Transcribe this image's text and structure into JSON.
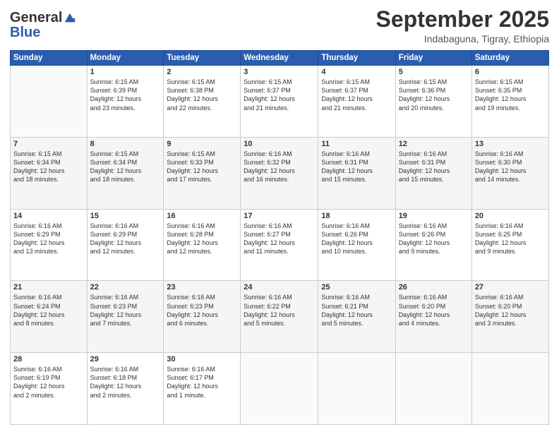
{
  "header": {
    "logo_general": "General",
    "logo_blue": "Blue",
    "month": "September 2025",
    "location": "Indabaguna, Tigray, Ethiopia"
  },
  "weekdays": [
    "Sunday",
    "Monday",
    "Tuesday",
    "Wednesday",
    "Thursday",
    "Friday",
    "Saturday"
  ],
  "weeks": [
    [
      {
        "num": "",
        "text": ""
      },
      {
        "num": "1",
        "text": "Sunrise: 6:15 AM\nSunset: 6:39 PM\nDaylight: 12 hours\nand 23 minutes."
      },
      {
        "num": "2",
        "text": "Sunrise: 6:15 AM\nSunset: 6:38 PM\nDaylight: 12 hours\nand 22 minutes."
      },
      {
        "num": "3",
        "text": "Sunrise: 6:15 AM\nSunset: 6:37 PM\nDaylight: 12 hours\nand 21 minutes."
      },
      {
        "num": "4",
        "text": "Sunrise: 6:15 AM\nSunset: 6:37 PM\nDaylight: 12 hours\nand 21 minutes."
      },
      {
        "num": "5",
        "text": "Sunrise: 6:15 AM\nSunset: 6:36 PM\nDaylight: 12 hours\nand 20 minutes."
      },
      {
        "num": "6",
        "text": "Sunrise: 6:15 AM\nSunset: 6:35 PM\nDaylight: 12 hours\nand 19 minutes."
      }
    ],
    [
      {
        "num": "7",
        "text": "Sunrise: 6:15 AM\nSunset: 6:34 PM\nDaylight: 12 hours\nand 18 minutes."
      },
      {
        "num": "8",
        "text": "Sunrise: 6:15 AM\nSunset: 6:34 PM\nDaylight: 12 hours\nand 18 minutes."
      },
      {
        "num": "9",
        "text": "Sunrise: 6:15 AM\nSunset: 6:33 PM\nDaylight: 12 hours\nand 17 minutes."
      },
      {
        "num": "10",
        "text": "Sunrise: 6:16 AM\nSunset: 6:32 PM\nDaylight: 12 hours\nand 16 minutes."
      },
      {
        "num": "11",
        "text": "Sunrise: 6:16 AM\nSunset: 6:31 PM\nDaylight: 12 hours\nand 15 minutes."
      },
      {
        "num": "12",
        "text": "Sunrise: 6:16 AM\nSunset: 6:31 PM\nDaylight: 12 hours\nand 15 minutes."
      },
      {
        "num": "13",
        "text": "Sunrise: 6:16 AM\nSunset: 6:30 PM\nDaylight: 12 hours\nand 14 minutes."
      }
    ],
    [
      {
        "num": "14",
        "text": "Sunrise: 6:16 AM\nSunset: 6:29 PM\nDaylight: 12 hours\nand 13 minutes."
      },
      {
        "num": "15",
        "text": "Sunrise: 6:16 AM\nSunset: 6:29 PM\nDaylight: 12 hours\nand 12 minutes."
      },
      {
        "num": "16",
        "text": "Sunrise: 6:16 AM\nSunset: 6:28 PM\nDaylight: 12 hours\nand 12 minutes."
      },
      {
        "num": "17",
        "text": "Sunrise: 6:16 AM\nSunset: 6:27 PM\nDaylight: 12 hours\nand 11 minutes."
      },
      {
        "num": "18",
        "text": "Sunrise: 6:16 AM\nSunset: 6:26 PM\nDaylight: 12 hours\nand 10 minutes."
      },
      {
        "num": "19",
        "text": "Sunrise: 6:16 AM\nSunset: 6:26 PM\nDaylight: 12 hours\nand 9 minutes."
      },
      {
        "num": "20",
        "text": "Sunrise: 6:16 AM\nSunset: 6:25 PM\nDaylight: 12 hours\nand 9 minutes."
      }
    ],
    [
      {
        "num": "21",
        "text": "Sunrise: 6:16 AM\nSunset: 6:24 PM\nDaylight: 12 hours\nand 8 minutes."
      },
      {
        "num": "22",
        "text": "Sunrise: 6:16 AM\nSunset: 6:23 PM\nDaylight: 12 hours\nand 7 minutes."
      },
      {
        "num": "23",
        "text": "Sunrise: 6:16 AM\nSunset: 6:23 PM\nDaylight: 12 hours\nand 6 minutes."
      },
      {
        "num": "24",
        "text": "Sunrise: 6:16 AM\nSunset: 6:22 PM\nDaylight: 12 hours\nand 5 minutes."
      },
      {
        "num": "25",
        "text": "Sunrise: 6:16 AM\nSunset: 6:21 PM\nDaylight: 12 hours\nand 5 minutes."
      },
      {
        "num": "26",
        "text": "Sunrise: 6:16 AM\nSunset: 6:20 PM\nDaylight: 12 hours\nand 4 minutes."
      },
      {
        "num": "27",
        "text": "Sunrise: 6:16 AM\nSunset: 6:20 PM\nDaylight: 12 hours\nand 3 minutes."
      }
    ],
    [
      {
        "num": "28",
        "text": "Sunrise: 6:16 AM\nSunset: 6:19 PM\nDaylight: 12 hours\nand 2 minutes."
      },
      {
        "num": "29",
        "text": "Sunrise: 6:16 AM\nSunset: 6:18 PM\nDaylight: 12 hours\nand 2 minutes."
      },
      {
        "num": "30",
        "text": "Sunrise: 6:16 AM\nSunset: 6:17 PM\nDaylight: 12 hours\nand 1 minute."
      },
      {
        "num": "",
        "text": ""
      },
      {
        "num": "",
        "text": ""
      },
      {
        "num": "",
        "text": ""
      },
      {
        "num": "",
        "text": ""
      }
    ]
  ]
}
